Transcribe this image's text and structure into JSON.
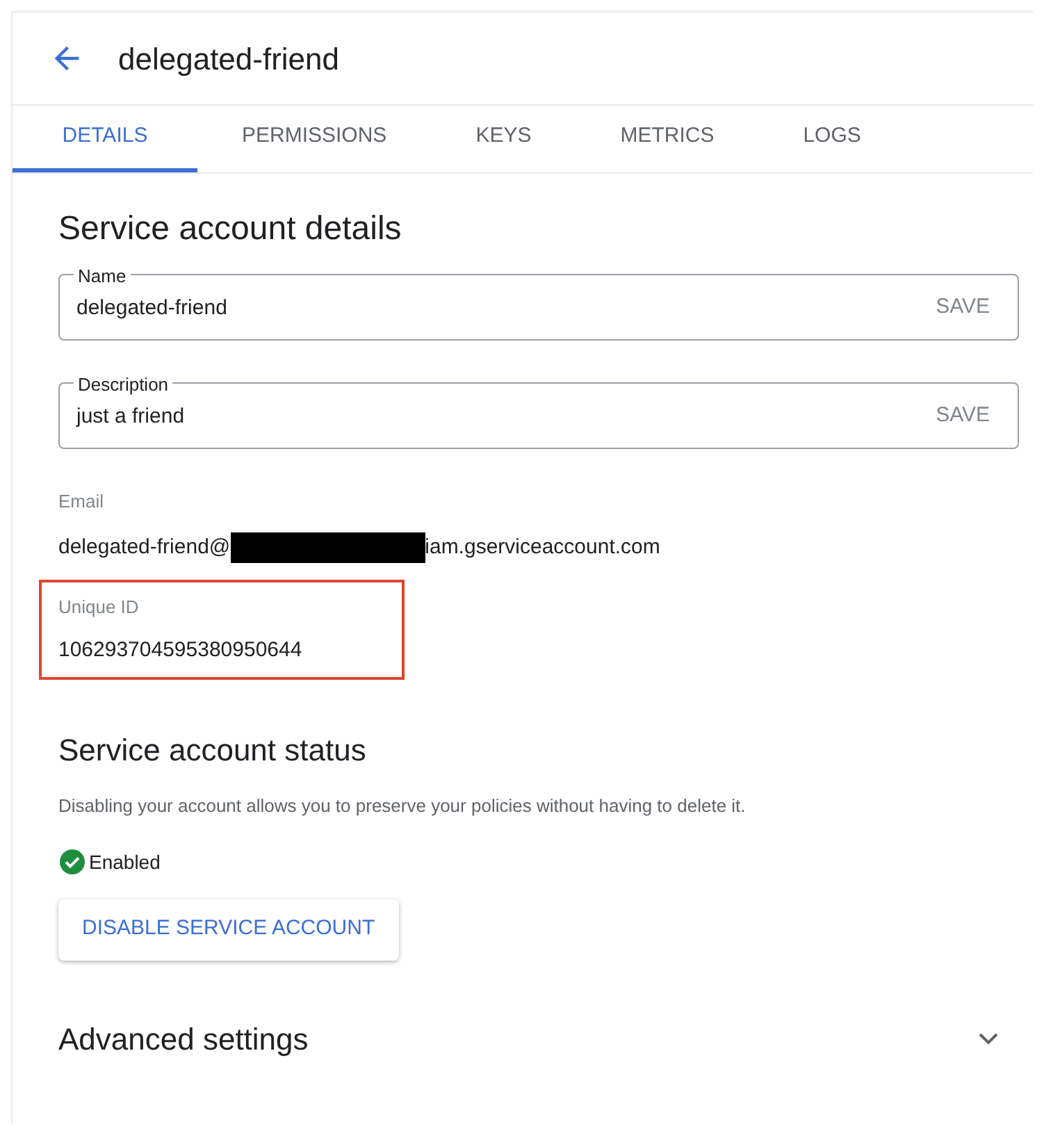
{
  "header": {
    "title": "delegated-friend"
  },
  "tabs": [
    {
      "label": "DETAILS",
      "selected": true
    },
    {
      "label": "PERMISSIONS",
      "selected": false
    },
    {
      "label": "KEYS",
      "selected": false
    },
    {
      "label": "METRICS",
      "selected": false
    },
    {
      "label": "LOGS",
      "selected": false
    }
  ],
  "details": {
    "heading": "Service account details",
    "fields": [
      {
        "label": "Name",
        "value": "delegated-friend",
        "action": "SAVE"
      },
      {
        "label": "Description",
        "value": "just a friend",
        "action": "SAVE"
      }
    ],
    "email": {
      "label": "Email",
      "prefix": "delegated-friend@",
      "redacted": true,
      "suffix": "iam.gserviceaccount.com"
    },
    "unique_id": {
      "label": "Unique ID",
      "value": "106293704595380950644",
      "highlighted": true
    }
  },
  "status": {
    "heading": "Service account status",
    "description": "Disabling your account allows you to preserve your policies without having to delete it.",
    "enabled": true,
    "state_label": "Enabled",
    "button": "DISABLE SERVICE ACCOUNT"
  },
  "advanced": {
    "heading": "Advanced settings",
    "expanded": false
  }
}
